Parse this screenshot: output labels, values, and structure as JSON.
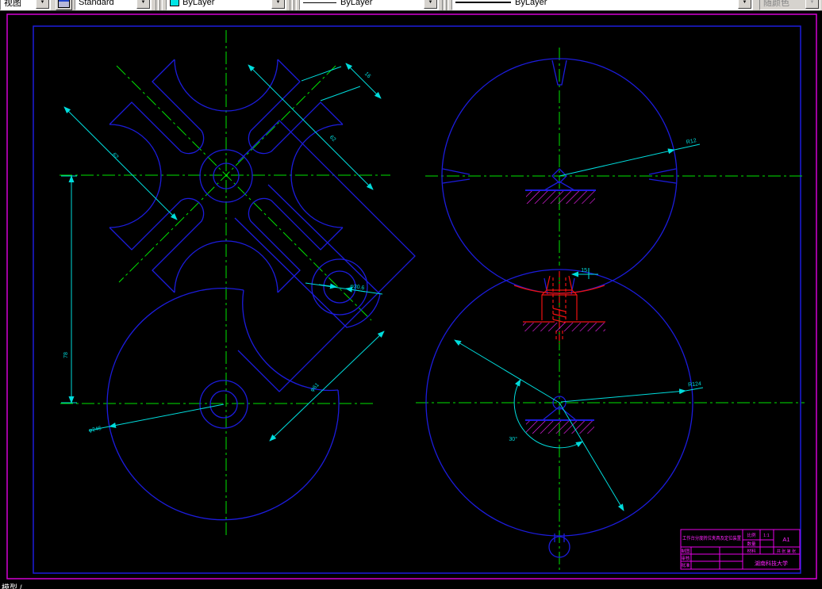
{
  "toolbar": {
    "dropdown_arrow": "▼",
    "view_combo": {
      "value": "视图"
    },
    "style_combo": {
      "value": "Standard"
    },
    "color_combo": {
      "value": "ByLayer",
      "swatch_color": "#00e5e5"
    },
    "linetype_combo": {
      "value": "ByLayer"
    },
    "lineweight_combo": {
      "value": "ByLayer"
    },
    "plotstyle_combo": {
      "value": "随颜色"
    }
  },
  "statusbar": {
    "tabs_fragment": "模型 /"
  },
  "dimensions": {
    "slot_width": "16",
    "diag_right": "62",
    "diag_left": "62",
    "boss_diameter": "φ30.6",
    "arm_width": "φ61",
    "center_distance": "78",
    "disc_diameter": "φ246",
    "wheel_radius": "R12",
    "lock_radius": "R124",
    "pawl_offset": "15",
    "lock_angle": "30°"
  },
  "title_block": {
    "title": "工作台分度转位夹具及定位装置",
    "scale_label": "比例",
    "scale_value": "1:1",
    "quantity_label": "数量",
    "material_label": "材料",
    "sheet_format": "A1",
    "sheet_info": "共 张 第 张",
    "drawn_label": "制图",
    "checked_label": "审核",
    "approved_label": "批准",
    "organization": "湖南科技大学"
  },
  "colors": {
    "geometry": "#1c1cdc",
    "centerline": "#00e400",
    "dimension": "#00dcdc",
    "annotation": "#ff22ff",
    "alert": "#ee1111",
    "frame": "#d400d4"
  }
}
